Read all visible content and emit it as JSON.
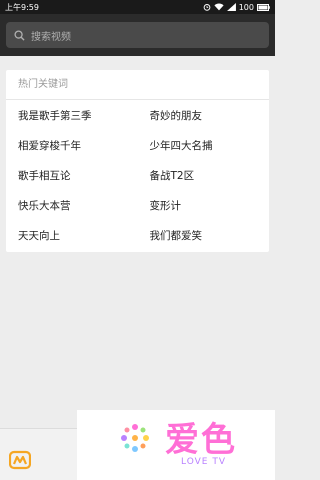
{
  "status": {
    "time": "上午9:59",
    "battery": "100"
  },
  "search": {
    "placeholder": "搜索视频"
  },
  "hot": {
    "title": "热门关键词",
    "keywords": [
      "我是歌手第三季",
      "奇妙的朋友",
      "相爱穿梭千年",
      "少年四大名捕",
      "歌手相互论",
      "备战T2区",
      "快乐大本营",
      "变形计",
      "天天向上",
      "我们都爱笑"
    ]
  },
  "watermark": {
    "cn": "爱色",
    "en": "LOVE TV"
  },
  "colors": {
    "header": "#2b2b2b",
    "accent": "#f5a623",
    "watermark_pink": "#ff6fd6"
  }
}
